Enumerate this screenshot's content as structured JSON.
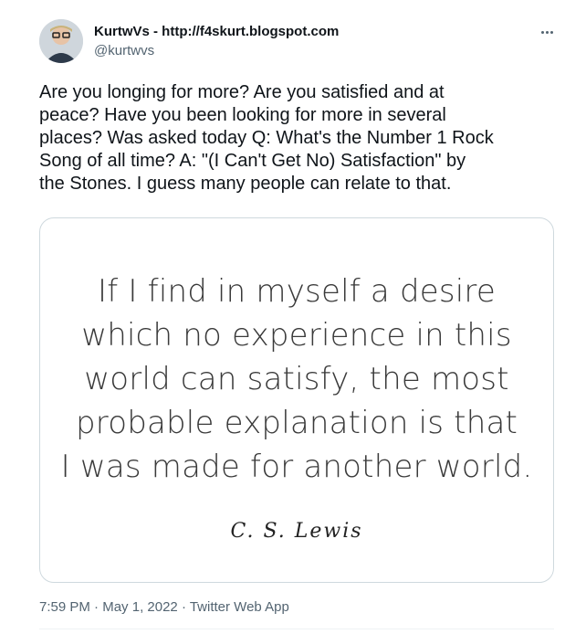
{
  "author": {
    "display_name": "KurtwVs - http://f4skurt.blogspot.com",
    "handle": "@kurtwvs"
  },
  "tweet": {
    "text": "Are you longing for more? Are you satisfied and at\npeace? Have you been looking for more in several\nplaces? Was asked today Q: What's the Number 1 Rock\nSong of all time? A: \"(I Can't Get No) Satisfaction\" by\nthe Stones. I guess many people can relate to that."
  },
  "media": {
    "quote_text": "If I find in myself a desire\nwhich no experience in this\nworld can satisfy, the most\nprobable explanation is that\nI was made for another world.",
    "quote_author": "C. S. Lewis"
  },
  "meta": {
    "time": "7:59 PM",
    "separator": " · ",
    "date": "May 1, 2022",
    "source": "Twitter Web App"
  },
  "icons": {
    "more": "more-horizontal-icon",
    "avatar": "user-avatar"
  },
  "colors": {
    "text_primary": "#0f1419",
    "text_secondary": "#536471",
    "border": "#cfd9de"
  }
}
